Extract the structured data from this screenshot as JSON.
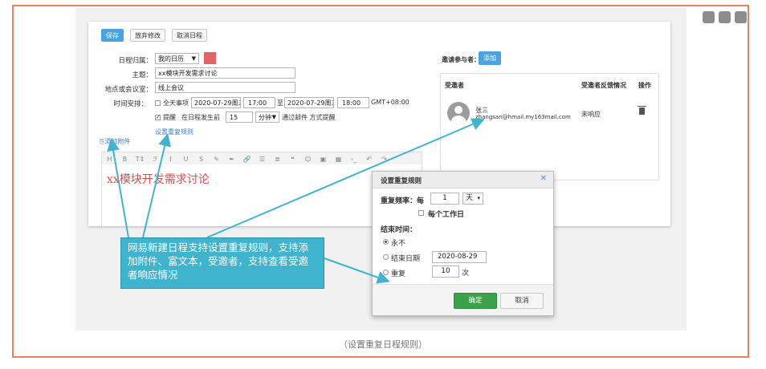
{
  "toolbar": {
    "save": "保存",
    "discard": "放弃修改",
    "cancel": "取消日程"
  },
  "form": {
    "owner_label": "日程归属：",
    "owner_value": "我的日历",
    "subject_label": "主题：",
    "subject_value": "xx模块开发需求讨论",
    "place_label": "地点或会议室：",
    "place_value": "线上会议",
    "time_label": "时间安排：",
    "allday": "全天事项",
    "start_date": "2020-07-29周三",
    "start_time": "17:00",
    "to": "至",
    "end_date": "2020-07-29周三",
    "end_time": "18:00",
    "tz": "GMT+08:00",
    "remind": "提醒",
    "remind_before": "在日程发生前",
    "remind_value": "15",
    "remind_unit": "分钟",
    "remind_via": "通过邮件 方式提醒",
    "repeat_link": "设置重复规则",
    "attach_link": "添加附件"
  },
  "editor": {
    "toolbar_icons": [
      "H",
      "B",
      "T↕",
      "ℱ",
      "I",
      "U",
      "S",
      "✎",
      "✒",
      "🔗",
      "☰",
      "≣",
      "❝",
      "☺",
      "▣",
      "▦",
      "›_",
      "↶",
      "↷"
    ],
    "content": "xx模块开发需求讨论"
  },
  "invitees": {
    "label": "邀请参与者：",
    "add_button": "添加",
    "headers": {
      "name": "受邀者",
      "status": "受邀者反馈情况",
      "action": "操作"
    },
    "rows": [
      {
        "name": "张三",
        "email": "zhangsan@hmail.my163mail.com",
        "status": "未响应"
      }
    ]
  },
  "dialog": {
    "title": "设置重复规则",
    "freq_label": "重复频率：每",
    "freq_value": "1",
    "freq_unit": "天",
    "workday": "每个工作日",
    "end_label": "结束时间：",
    "never": "永不",
    "end_date_label": "结束日期",
    "end_date_value": "2020-08-29",
    "repeat_label": "重复",
    "repeat_value": "10",
    "repeat_unit": "次",
    "ok": "确定",
    "cancel": "取消"
  },
  "callout": "网易新建日程支持设置重复规则，支持添加附件、富文本，受邀者，支持查看受邀者响应情况",
  "caption": "（设置重复日程规则）",
  "colors": {
    "accent": "#4aa3df",
    "callout": "#3eb4cf",
    "frame": "#e8825d",
    "ok": "#3aa34a",
    "color_swatch": "#e06666"
  }
}
